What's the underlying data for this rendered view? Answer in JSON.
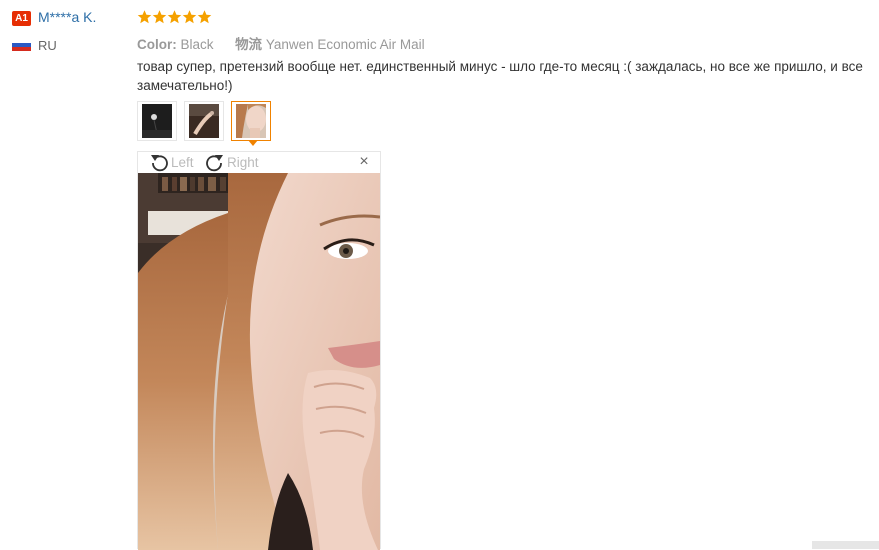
{
  "reviewer": {
    "level_badge": "A1",
    "name": "M****a K.",
    "country_code": "RU"
  },
  "rating": {
    "stars": 5,
    "max": 5,
    "color": "#f5a100"
  },
  "meta": {
    "color_key": "Color:",
    "color_value": "Black",
    "shipping_key": "物流",
    "shipping_value": "Yanwen Economic Air Mail"
  },
  "review": {
    "text": "товар супер, претензий вообще нет. единственный минус - шло где-то месяц :( заждалась, но все же пришло, и все замечательно!)"
  },
  "photos": {
    "thumbnail_count": 3,
    "active_index": 2
  },
  "viewer": {
    "rotate_left_label": "Left",
    "rotate_right_label": "Right",
    "close_symbol": "×"
  },
  "colors": {
    "accent": "#f08200",
    "badge": "#e62e04",
    "link": "#2e6fa7"
  }
}
